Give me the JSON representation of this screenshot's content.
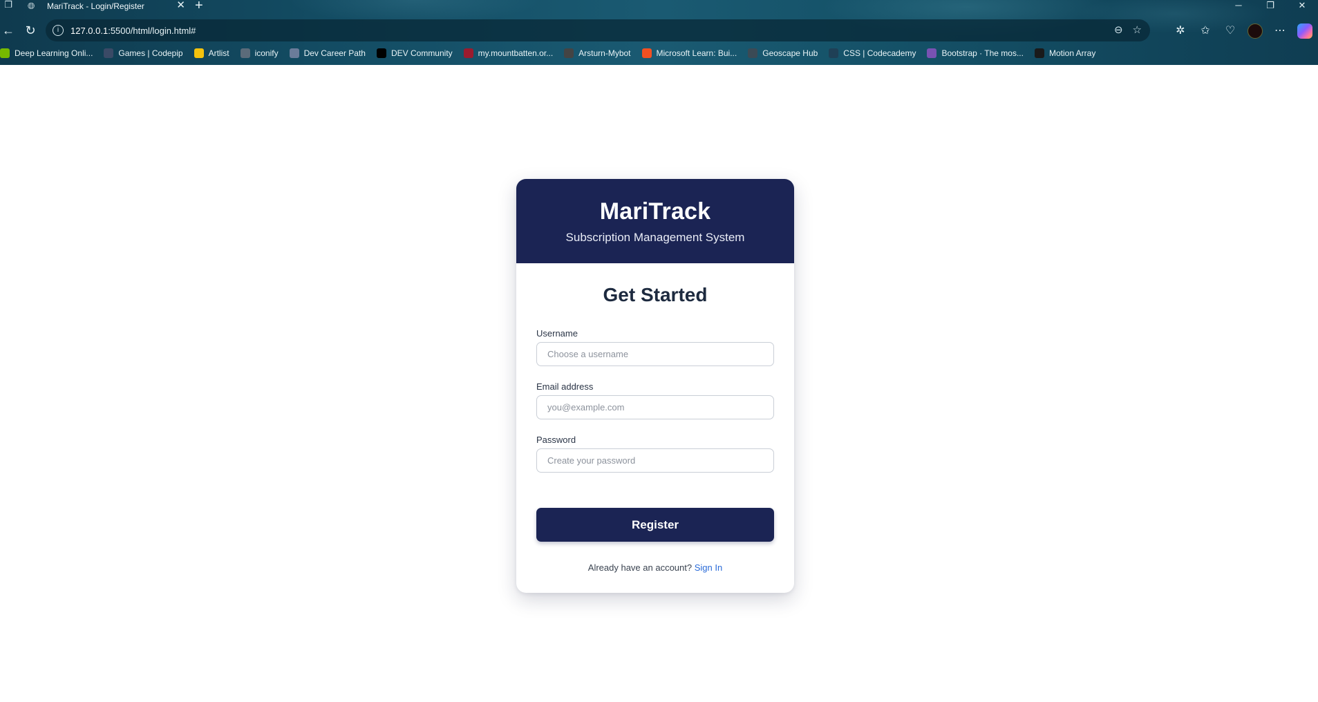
{
  "browser": {
    "tab_title": "MariTrack - Login/Register",
    "url_host": "127.0.0.1",
    "url_rest": ":5500/html/login.html#",
    "bookmarks": [
      {
        "label": "Deep Learning Onli...",
        "color": "#76b900",
        "icon": "nvidia-icon"
      },
      {
        "label": "Games | Codepip",
        "color": "#3a4a66",
        "icon": "codepip-icon"
      },
      {
        "label": "Artlist",
        "color": "#f4c20d",
        "icon": "artlist-icon"
      },
      {
        "label": "iconify",
        "color": "#5b6b7a",
        "icon": "iconify-icon"
      },
      {
        "label": "Dev Career Path",
        "color": "#6b7c9a",
        "icon": "dev-career-path-icon"
      },
      {
        "label": "DEV Community",
        "color": "#000000",
        "icon": "dev-community-icon"
      },
      {
        "label": "my.mountbatten.or...",
        "color": "#9a1b2e",
        "icon": "mountbatten-icon"
      },
      {
        "label": "Arsturn-Mybot",
        "color": "#444444",
        "icon": "arsturn-icon"
      },
      {
        "label": "Microsoft Learn: Bui...",
        "color": "#f25022",
        "icon": "microsoft-icon"
      },
      {
        "label": "Geoscape Hub",
        "color": "#3b4a55",
        "icon": "geoscape-icon"
      },
      {
        "label": "CSS | Codecademy",
        "color": "#1f4056",
        "icon": "codecademy-icon"
      },
      {
        "label": "Bootstrap · The mos...",
        "color": "#7952b3",
        "icon": "bootstrap-icon"
      },
      {
        "label": "Motion Array",
        "color": "#1a1a1a",
        "icon": "motion-array-icon"
      }
    ]
  },
  "app": {
    "brand": "MariTrack",
    "subtitle": "Subscription Management System",
    "heading": "Get Started",
    "colors": {
      "primary": "#1b2454",
      "link": "#2a6bd8"
    }
  },
  "form": {
    "username": {
      "label": "Username",
      "placeholder": "Choose a username",
      "value": ""
    },
    "email": {
      "label": "Email address",
      "placeholder": "you@example.com",
      "value": ""
    },
    "password": {
      "label": "Password",
      "placeholder": "Create your password",
      "value": ""
    },
    "submit_label": "Register",
    "footer_text": "Already have an account? ",
    "footer_link": "Sign In"
  }
}
